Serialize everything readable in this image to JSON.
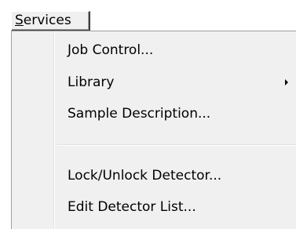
{
  "menubar": {
    "services": {
      "mnemonic": "S",
      "rest": "ervices"
    }
  },
  "menu": {
    "items": [
      {
        "label": "Job Control..."
      },
      {
        "label": "Library",
        "has_submenu": true
      },
      {
        "label": "Sample Description..."
      },
      {
        "label": "Lock/Unlock Detector..."
      },
      {
        "label": "Edit Detector List..."
      }
    ],
    "submenu_arrow_icon": "submenu-arrow-icon"
  }
}
